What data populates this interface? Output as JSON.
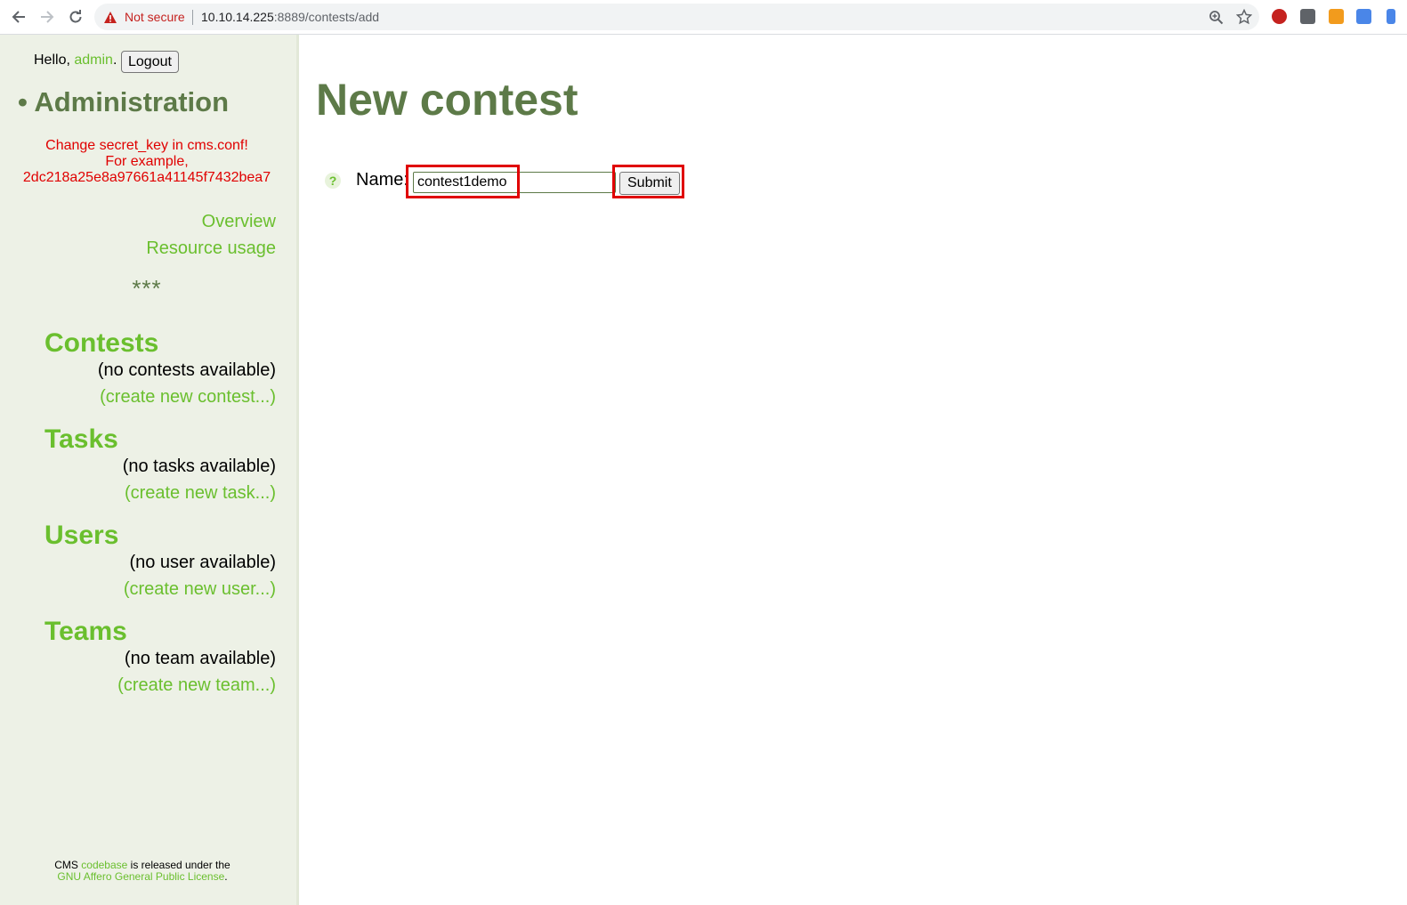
{
  "browser": {
    "security_label": "Not secure",
    "url_host": "10.10.14.225",
    "url_rest": ":8889/contests/add"
  },
  "sidebar": {
    "greeting_prefix": "Hello, ",
    "username": "admin",
    "greeting_suffix": ".",
    "logout_label": "Logout",
    "admin_title": "• Administration",
    "secret_warning_line1": "Change secret_key in cms.conf!",
    "secret_warning_line2": "For example,",
    "secret_warning_line3": "2dc218a25e8a97661a41145f7432bea7",
    "overview_link": "Overview",
    "resource_usage_link": "Resource usage",
    "separator": "***",
    "sections": [
      {
        "title": "Contests",
        "empty": "(no contests available)",
        "create": "(create new contest...)"
      },
      {
        "title": "Tasks",
        "empty": "(no tasks available)",
        "create": "(create new task...)"
      },
      {
        "title": "Users",
        "empty": "(no user available)",
        "create": "(create new user...)"
      },
      {
        "title": "Teams",
        "empty": "(no team available)",
        "create": "(create new team...)"
      }
    ],
    "footer": {
      "prefix": "CMS ",
      "codebase_link": "codebase",
      "middle": " is released under the",
      "license_link": "GNU Affero General Public License",
      "suffix": "."
    }
  },
  "main": {
    "title": "New contest",
    "help_icon": "?",
    "name_label": "Name:",
    "name_value": "contest1demo",
    "submit_label": "Submit"
  },
  "colors": {
    "accent_green": "#6abf2e",
    "title_green": "#5d7a48",
    "warning_red": "#e00000",
    "sidebar_bg": "#edf1e6"
  }
}
